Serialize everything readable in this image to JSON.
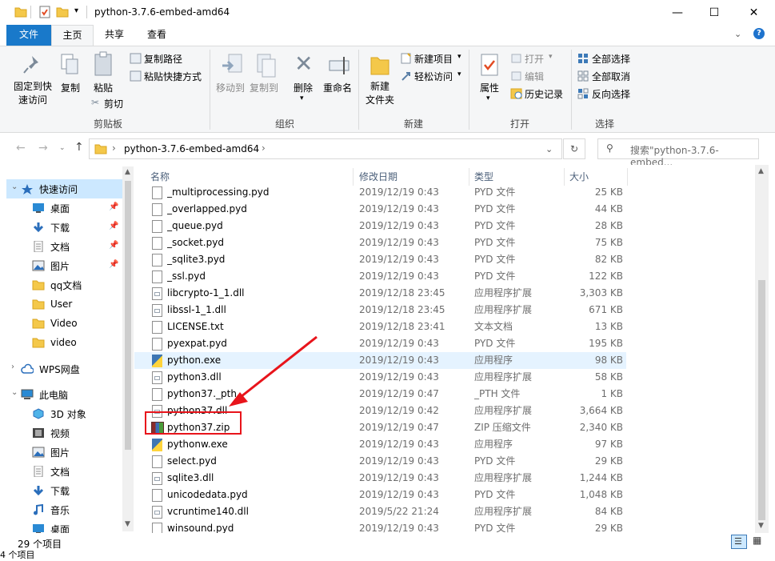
{
  "window": {
    "title": "python-3.7.6-embed-amd64",
    "min": "—",
    "max": "☐",
    "close": "✕"
  },
  "tabs": [
    {
      "label": "文件"
    },
    {
      "label": "主页"
    },
    {
      "label": "共享"
    },
    {
      "label": "查看"
    }
  ],
  "ribbon": {
    "pin": "固定到快\n速访问",
    "copy": "复制",
    "paste": "粘贴",
    "copy_path": "复制路径",
    "paste_shortcut": "粘贴快捷方式",
    "cut": "剪切",
    "clipboard": "剪贴板",
    "move_to": "移动到",
    "copy_to": "复制到",
    "delete": "删除",
    "rename": "重命名",
    "organize": "组织",
    "new_folder": "新建\n文件夹",
    "new_item": "新建项目",
    "easy_access": "轻松访问",
    "new": "新建",
    "properties": "属性",
    "open": "打开",
    "edit": "编辑",
    "history": "历史记录",
    "open_group": "打开",
    "select_all": "全部选择",
    "select_none": "全部取消",
    "invert": "反向选择",
    "select": "选择"
  },
  "address": {
    "path": "python-3.7.6-embed-amd64",
    "search_placeholder": "搜索\"python-3.7.6-embed..."
  },
  "nav": [
    {
      "label": "快速访问",
      "icon": "star-icon"
    },
    {
      "label": "桌面",
      "icon": "desktop-icon"
    },
    {
      "label": "下载",
      "icon": "download-icon"
    },
    {
      "label": "文档",
      "icon": "document-icon"
    },
    {
      "label": "图片",
      "icon": "picture-icon"
    },
    {
      "label": "qq文档",
      "icon": "folder-icon"
    },
    {
      "label": "User",
      "icon": "folder-icon"
    },
    {
      "label": "Video",
      "icon": "folder-icon"
    },
    {
      "label": "video",
      "icon": "folder-icon"
    },
    {
      "label": "WPS网盘",
      "icon": "cloud-icon"
    },
    {
      "label": "此电脑",
      "icon": "computer-icon"
    },
    {
      "label": "3D 对象",
      "icon": "cube-icon"
    },
    {
      "label": "视频",
      "icon": "video-icon"
    },
    {
      "label": "图片",
      "icon": "picture-icon"
    },
    {
      "label": "文档",
      "icon": "document-icon"
    },
    {
      "label": "下载",
      "icon": "download-icon"
    },
    {
      "label": "音乐",
      "icon": "music-icon"
    },
    {
      "label": "桌面",
      "icon": "desktop-icon"
    }
  ],
  "columns": {
    "name": "名称",
    "date": "修改日期",
    "type": "类型",
    "size": "大小"
  },
  "files": [
    {
      "name": "_multiprocessing.pyd",
      "date": "2019/12/19 0:43",
      "type": "PYD 文件",
      "size": "25 KB"
    },
    {
      "name": "_overlapped.pyd",
      "date": "2019/12/19 0:43",
      "type": "PYD 文件",
      "size": "44 KB"
    },
    {
      "name": "_queue.pyd",
      "date": "2019/12/19 0:43",
      "type": "PYD 文件",
      "size": "28 KB"
    },
    {
      "name": "_socket.pyd",
      "date": "2019/12/19 0:43",
      "type": "PYD 文件",
      "size": "75 KB"
    },
    {
      "name": "_sqlite3.pyd",
      "date": "2019/12/19 0:43",
      "type": "PYD 文件",
      "size": "82 KB"
    },
    {
      "name": "_ssl.pyd",
      "date": "2019/12/19 0:43",
      "type": "PYD 文件",
      "size": "122 KB"
    },
    {
      "name": "libcrypto-1_1.dll",
      "date": "2019/12/18 23:45",
      "type": "应用程序扩展",
      "size": "3,303 KB"
    },
    {
      "name": "libssl-1_1.dll",
      "date": "2019/12/18 23:45",
      "type": "应用程序扩展",
      "size": "671 KB"
    },
    {
      "name": "LICENSE.txt",
      "date": "2019/12/18 23:41",
      "type": "文本文档",
      "size": "13 KB"
    },
    {
      "name": "pyexpat.pyd",
      "date": "2019/12/19 0:43",
      "type": "PYD 文件",
      "size": "195 KB"
    },
    {
      "name": "python.exe",
      "date": "2019/12/19 0:43",
      "type": "应用程序",
      "size": "98 KB"
    },
    {
      "name": "python3.dll",
      "date": "2019/12/19 0:43",
      "type": "应用程序扩展",
      "size": "58 KB"
    },
    {
      "name": "python37._pth",
      "date": "2019/12/19 0:47",
      "type": "_PTH 文件",
      "size": "1 KB"
    },
    {
      "name": "python37.dll",
      "date": "2019/12/19 0:42",
      "type": "应用程序扩展",
      "size": "3,664 KB"
    },
    {
      "name": "python37.zip",
      "date": "2019/12/19 0:47",
      "type": "ZIP 压缩文件",
      "size": "2,340 KB"
    },
    {
      "name": "pythonw.exe",
      "date": "2019/12/19 0:43",
      "type": "应用程序",
      "size": "97 KB"
    },
    {
      "name": "select.pyd",
      "date": "2019/12/19 0:43",
      "type": "PYD 文件",
      "size": "29 KB"
    },
    {
      "name": "sqlite3.dll",
      "date": "2019/12/19 0:43",
      "type": "应用程序扩展",
      "size": "1,244 KB"
    },
    {
      "name": "unicodedata.pyd",
      "date": "2019/12/19 0:43",
      "type": "PYD 文件",
      "size": "1,048 KB"
    },
    {
      "name": "vcruntime140.dll",
      "date": "2019/5/22 21:24",
      "type": "应用程序扩展",
      "size": "84 KB"
    },
    {
      "name": "winsound.pyd",
      "date": "2019/12/19 0:43",
      "type": "PYD 文件",
      "size": "29 KB"
    }
  ],
  "status": {
    "count": "29 个项目",
    "left_cut": "4 个项目"
  },
  "colors": {
    "file_tab": "#1979ca",
    "annotation": "#e8141b",
    "selected_row": "#e5f3ff",
    "quick_access_bg": "#cce8ff"
  }
}
